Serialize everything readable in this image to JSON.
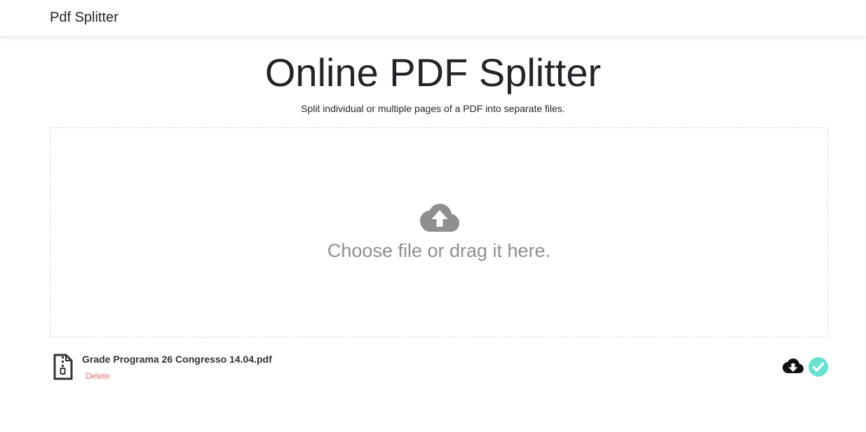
{
  "navbar": {
    "brand": "Pdf Splitter"
  },
  "hero": {
    "title": "Online PDF Splitter",
    "subtitle": "Split individual or multiple pages of a PDF into separate files."
  },
  "dropzone": {
    "text": "Choose file or drag it here.",
    "icon": "cloud-upload-icon"
  },
  "files": [
    {
      "name": "Grade Programa 26 Congresso 14.04.pdf",
      "delete_label": "Delete",
      "icon": "file-zip-icon",
      "download_icon": "cloud-download-icon",
      "status_icon": "check-circle-icon",
      "status_color": "#6ce0d0"
    }
  ],
  "colors": {
    "delete": "#e0706f",
    "dropzone_text": "#8f8f8f",
    "success": "#6ce0d0"
  }
}
